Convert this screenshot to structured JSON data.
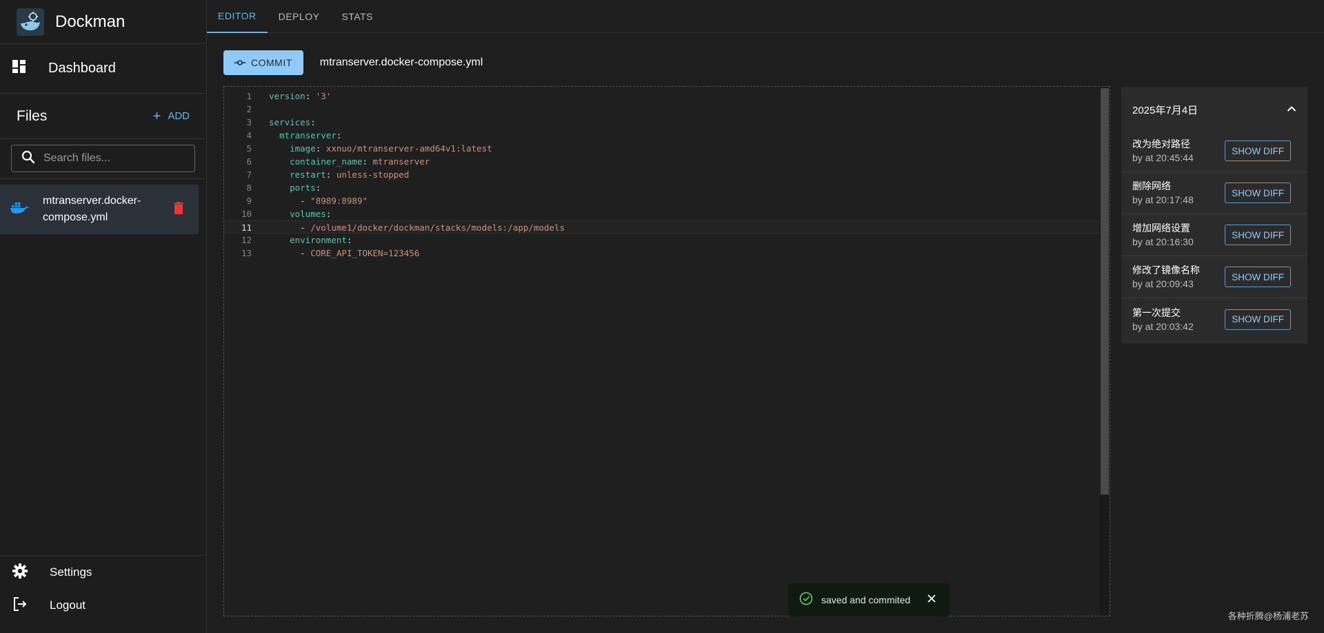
{
  "app": {
    "title": "Dockman"
  },
  "sidebar": {
    "dashboard_label": "Dashboard",
    "files_title": "Files",
    "add_label": "ADD",
    "search_placeholder": "Search files...",
    "files": [
      {
        "name": "mtranserver.docker-compose.yml"
      }
    ],
    "settings_label": "Settings",
    "logout_label": "Logout"
  },
  "tabs": [
    {
      "label": "EDITOR",
      "active": true
    },
    {
      "label": "DEPLOY",
      "active": false
    },
    {
      "label": "STATS",
      "active": false
    }
  ],
  "toolbar": {
    "commit_label": "COMMIT",
    "filename": "mtranserver.docker-compose.yml"
  },
  "editor": {
    "current_line": 11,
    "lines": [
      {
        "n": "1",
        "tokens": [
          {
            "t": "version",
            "c": "k"
          },
          {
            "t": ": ",
            "c": "p"
          },
          {
            "t": "'3'",
            "c": "s"
          }
        ]
      },
      {
        "n": "2",
        "tokens": []
      },
      {
        "n": "3",
        "tokens": [
          {
            "t": "services",
            "c": "k"
          },
          {
            "t": ":",
            "c": "p"
          }
        ]
      },
      {
        "n": "4",
        "tokens": [
          {
            "t": "  "
          },
          {
            "t": "mtranserver",
            "c": "k"
          },
          {
            "t": ":",
            "c": "p"
          }
        ]
      },
      {
        "n": "5",
        "tokens": [
          {
            "t": "    "
          },
          {
            "t": "image",
            "c": "k"
          },
          {
            "t": ": ",
            "c": "p"
          },
          {
            "t": "xxnuo/mtranserver-amd64v1:latest",
            "c": "s"
          }
        ]
      },
      {
        "n": "6",
        "tokens": [
          {
            "t": "    "
          },
          {
            "t": "container_name",
            "c": "k"
          },
          {
            "t": ": ",
            "c": "p"
          },
          {
            "t": "mtranserver",
            "c": "s"
          }
        ]
      },
      {
        "n": "7",
        "tokens": [
          {
            "t": "    "
          },
          {
            "t": "restart",
            "c": "k"
          },
          {
            "t": ": ",
            "c": "p"
          },
          {
            "t": "unless-stopped",
            "c": "s"
          }
        ]
      },
      {
        "n": "8",
        "tokens": [
          {
            "t": "    "
          },
          {
            "t": "ports",
            "c": "k"
          },
          {
            "t": ":",
            "c": "p"
          }
        ]
      },
      {
        "n": "9",
        "tokens": [
          {
            "t": "      - ",
            "c": "p"
          },
          {
            "t": "\"8989:8989\"",
            "c": "s"
          }
        ]
      },
      {
        "n": "10",
        "tokens": [
          {
            "t": "    "
          },
          {
            "t": "volumes",
            "c": "k"
          },
          {
            "t": ":",
            "c": "p"
          }
        ]
      },
      {
        "n": "11",
        "tokens": [
          {
            "t": "      - ",
            "c": "p"
          },
          {
            "t": "/volume1/docker/dockman/stacks/models:/app/models",
            "c": "s"
          }
        ]
      },
      {
        "n": "12",
        "tokens": [
          {
            "t": "    "
          },
          {
            "t": "environment",
            "c": "k"
          },
          {
            "t": ":",
            "c": "p"
          }
        ]
      },
      {
        "n": "13",
        "tokens": [
          {
            "t": "      - ",
            "c": "p"
          },
          {
            "t": "CORE_API_TOKEN=123456",
            "c": "s"
          }
        ]
      }
    ]
  },
  "history": {
    "date": "2025年7月4日",
    "show_diff_label": "SHOW DIFF",
    "commits": [
      {
        "message": "改为绝对路径",
        "time": "by at 20:45:44"
      },
      {
        "message": "删除网络",
        "time": "by at 20:17:48"
      },
      {
        "message": "增加网络设置",
        "time": "by at 20:16:30"
      },
      {
        "message": "修改了镜像名称",
        "time": "by at 20:09:43"
      },
      {
        "message": "第一次提交",
        "time": "by at 20:03:42"
      }
    ]
  },
  "toast": {
    "message": "saved and commited"
  },
  "watermark": "各种折腾@杨浦老苏",
  "colors": {
    "accent": "#64b5f6",
    "commit_button": "#90caf9",
    "delete": "#e53935",
    "success": "#66bb6a",
    "docker": "#2496ed"
  }
}
